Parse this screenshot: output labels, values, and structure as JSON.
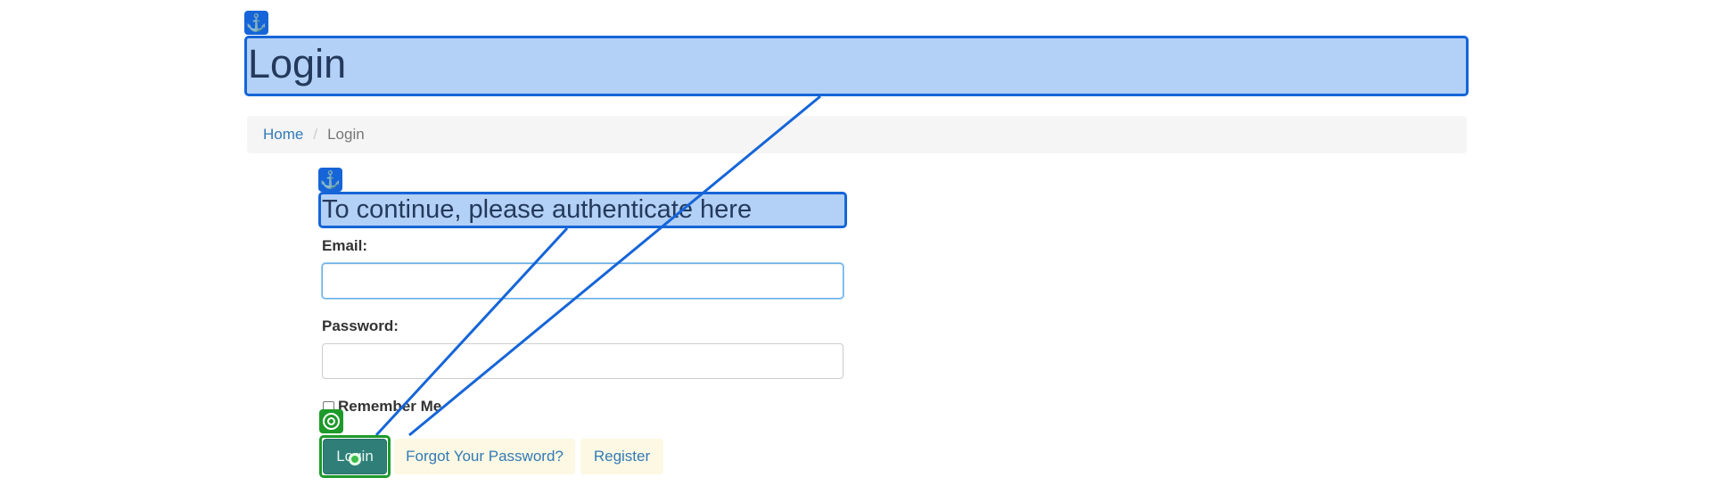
{
  "page": {
    "title": "Login"
  },
  "breadcrumb": {
    "home": "Home",
    "separator": "/",
    "current": "Login"
  },
  "form": {
    "subtitle": "To continue, please authenticate here",
    "email_label": "Email:",
    "email_value": "",
    "password_label": "Password:",
    "password_value": "",
    "remember_label": "Remember Me",
    "remember_checked": false
  },
  "buttons": {
    "login": "Login",
    "forgot": "Forgot Your Password?",
    "register": "Register"
  },
  "overlay": {
    "anchor_icon": "anchor-icon",
    "target_icon": "target-icon",
    "anchor_color": "#1565d8",
    "target_color": "#1d9a2a"
  }
}
